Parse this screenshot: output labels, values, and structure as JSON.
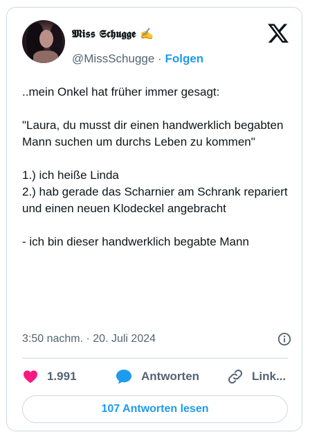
{
  "author": {
    "display_name": "𝕸𝖎𝖘𝖘 𝕾𝖈𝖍𝖚𝖌𝖌𝖊 ✍",
    "handle": "@MissSchugge",
    "separator": "·",
    "follow_label": "Folgen"
  },
  "tweet": {
    "text": "..mein Onkel hat früher immer gesagt:\n\n\"Laura, du musst dir einen handwerklich begabten Mann suchen um durchs Leben zu kommen\"\n\n1.) ich heiße Linda\n2.) hab gerade das Scharnier am Schrank repariert und einen neuen Klodeckel angebracht\n\n- ich bin dieser handwerklich begabte Mann",
    "timestamp": "3:50 nachm. · 20. Juli 2024"
  },
  "actions": {
    "like_count": "1.991",
    "reply_label": "Antworten",
    "link_label": "Link..."
  },
  "read_replies_label": "107 Antworten lesen",
  "colors": {
    "accent": "#1d9bf0",
    "like": "#f91880",
    "secondary_text": "#536471",
    "border": "#cfd9de"
  },
  "icons": [
    "x-logo-icon",
    "info-icon",
    "heart-icon",
    "reply-bubble-icon",
    "link-icon"
  ]
}
